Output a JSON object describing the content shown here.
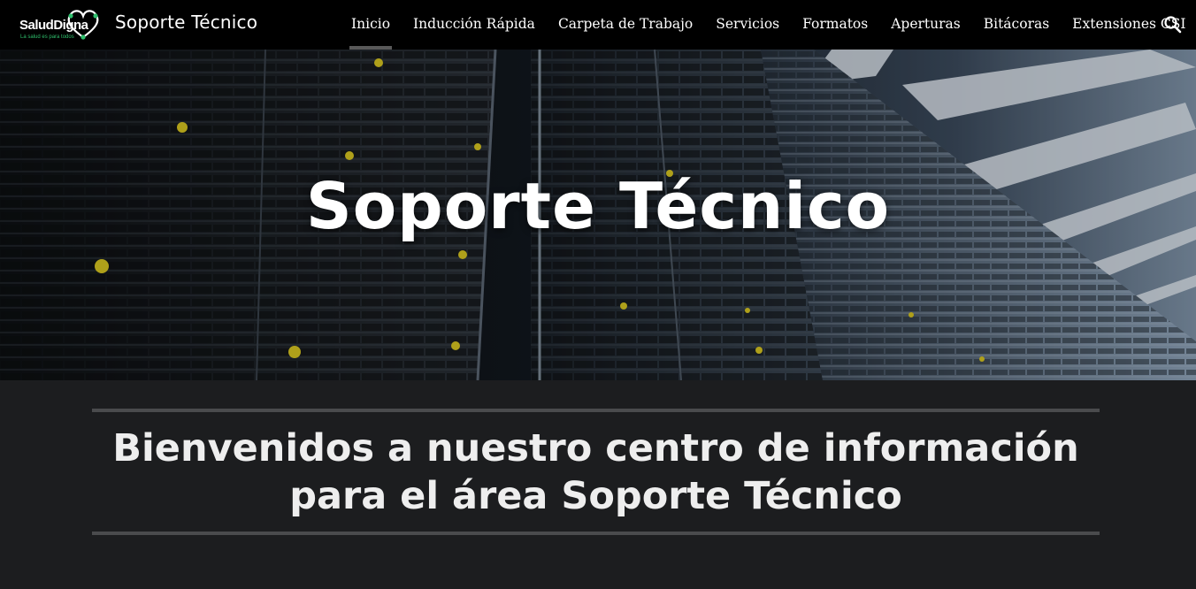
{
  "brand": {
    "logo_word_1": "Salud",
    "logo_word_2": "Digna",
    "logo_tagline": "La salud es para todos",
    "site_title": "Soporte Técnico"
  },
  "nav": {
    "items": [
      {
        "label": "Inicio",
        "active": true
      },
      {
        "label": "Inducción Rápida"
      },
      {
        "label": "Carpeta de Trabajo"
      },
      {
        "label": "Servicios"
      },
      {
        "label": "Formatos"
      },
      {
        "label": "Aperturas"
      },
      {
        "label": "Bitácoras"
      },
      {
        "label": "Extensiones CSI"
      }
    ],
    "search_icon": "search-icon"
  },
  "hero": {
    "title": "Soporte Técnico",
    "image": "server-racks-datacenter"
  },
  "main": {
    "welcome": "Bienvenidos a nuestro centro de información para el área Soporte Técnico"
  },
  "colors": {
    "header_bg": "#000000",
    "page_bg": "#1c1d1f",
    "brand_green": "#2fbf6c",
    "rule": "#4a4b4d"
  }
}
